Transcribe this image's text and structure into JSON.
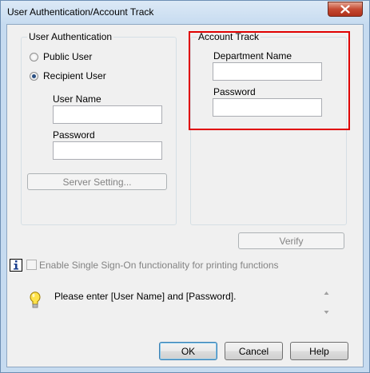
{
  "window": {
    "title": "User Authentication/Account Track"
  },
  "user_auth": {
    "group_label": "User Authentication",
    "public_user_label": "Public User",
    "recipient_user_label": "Recipient User",
    "selected": "Recipient User",
    "user_name_label": "User Name",
    "user_name_value": "",
    "password_label": "Password",
    "password_value": "",
    "server_setting_label": "Server Setting..."
  },
  "account_track": {
    "group_label": "Account Track",
    "department_name_label": "Department Name",
    "department_name_value": "",
    "password_label": "Password",
    "password_value": ""
  },
  "verify_label": "Verify",
  "sso": {
    "label": "Enable Single Sign-On functionality for printing functions",
    "checked": false
  },
  "message": {
    "text": "Please enter [User Name] and [Password]."
  },
  "buttons": {
    "ok": "OK",
    "cancel": "Cancel",
    "help": "Help"
  },
  "colors": {
    "highlight": "#e00000",
    "bulb": "#ffe34a"
  },
  "icons": [
    "close-icon",
    "info-icon",
    "lightbulb-icon",
    "scroll-up-icon",
    "scroll-down-icon"
  ]
}
